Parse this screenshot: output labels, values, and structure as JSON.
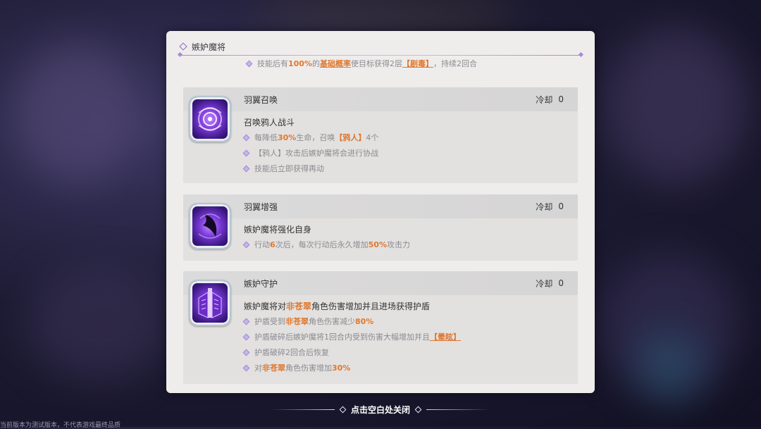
{
  "panel": {
    "title": "嫉妒魔将",
    "top_line": {
      "prefix": "技能后有",
      "pct": "100%",
      "mid1": "的",
      "base_rate": "基础概率",
      "mid2": "使目标获得2层",
      "status": "【剧毒】",
      "suffix": "，持续2回合"
    }
  },
  "skills": [
    {
      "name": "羽翼召唤",
      "cooldown_label": "冷却",
      "cooldown_value": "0",
      "description": "召唤鸦人战斗",
      "icon": "vortex-icon",
      "bullets": [
        {
          "a": "每降低",
          "b": "30%",
          "c": "生命，召唤",
          "d": "【鸦人】",
          "e": "4个"
        },
        {
          "text": "【鸦人】攻击后嫉妒魔将会进行协战"
        },
        {
          "text": "技能后立即获得再动"
        }
      ]
    },
    {
      "name": "羽翼增强",
      "cooldown_label": "冷却",
      "cooldown_value": "0",
      "description": "嫉妒魔将强化自身",
      "icon": "dark-wing-icon",
      "bullets": [
        {
          "a": "行动",
          "b": "6",
          "c": "次后，每次行动后永久增加",
          "d": "50%",
          "e": "攻击力"
        }
      ]
    },
    {
      "name": "嫉妒守护",
      "cooldown_label": "冷却",
      "cooldown_value": "0",
      "description_a": "嫉妒魔将对",
      "description_b": "非苍翠",
      "description_c": "角色伤害增加并且进场获得护盾",
      "icon": "shield-wings-icon",
      "bullets": [
        {
          "a": "护盾受到",
          "b": "非苍翠",
          "c": "角色伤害减少",
          "d": "80%"
        },
        {
          "a": "护盾破碎后嫉妒魔将1回合内受到伤害大幅增加并且",
          "b": "【晕眩】"
        },
        {
          "text": "护盾破碎2回合后恢复"
        },
        {
          "a": "对",
          "b": "非苍翠",
          "c": "角色伤害增加",
          "d": "30%"
        }
      ]
    }
  ],
  "close_hint": "点击空白处关闭",
  "version_note": "当前版本为测试版本，不代表游戏最终品质"
}
